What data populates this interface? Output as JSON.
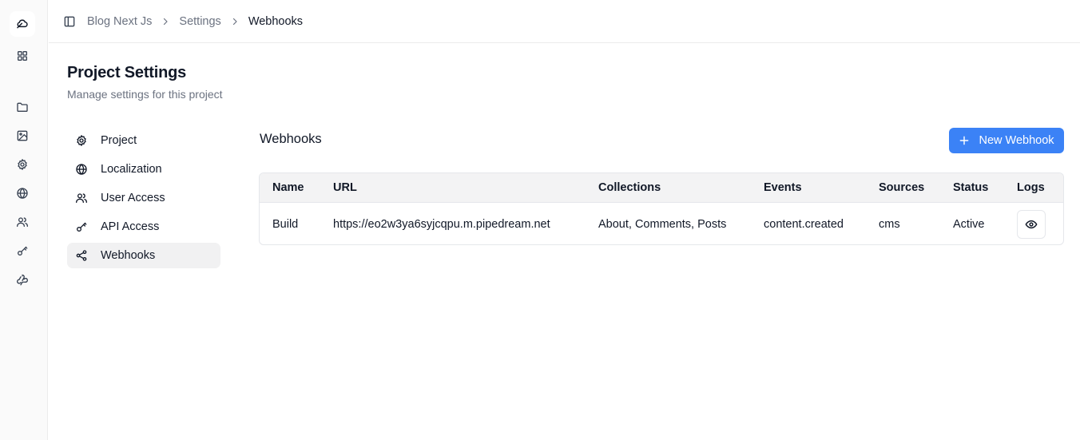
{
  "breadcrumb": {
    "items": [
      "Blog Next Js",
      "Settings",
      "Webhooks"
    ]
  },
  "rail": {
    "icons": [
      "cloud-logo-icon",
      "grid-icon",
      "folder-icon",
      "image-icon",
      "gear-icon",
      "globe-icon",
      "users-icon",
      "key-icon",
      "webhook-icon"
    ]
  },
  "page": {
    "title": "Project Settings",
    "subtitle": "Manage settings for this project"
  },
  "settings_nav": {
    "items": [
      {
        "label": "Project",
        "icon": "gear-icon"
      },
      {
        "label": "Localization",
        "icon": "globe-icon"
      },
      {
        "label": "User Access",
        "icon": "users-icon"
      },
      {
        "label": "API Access",
        "icon": "key-icon"
      },
      {
        "label": "Webhooks",
        "icon": "webhook-icon",
        "active": true
      }
    ]
  },
  "section": {
    "title": "Webhooks",
    "new_button_label": "New Webhook"
  },
  "table": {
    "columns": [
      "Name",
      "URL",
      "Collections",
      "Events",
      "Sources",
      "Status",
      "Logs"
    ],
    "rows": [
      {
        "name": "Build",
        "url": "https://eo2w3ya6syjcqpu.m.pipedream.net",
        "collections": "About, Comments, Posts",
        "events": "content.created",
        "sources": "cms",
        "status": "Active",
        "logs_icon": "eye-icon"
      }
    ]
  },
  "colors": {
    "accent": "#3b82f6",
    "text": "#111827",
    "muted": "#6b7280",
    "border": "#e5e7eb"
  }
}
